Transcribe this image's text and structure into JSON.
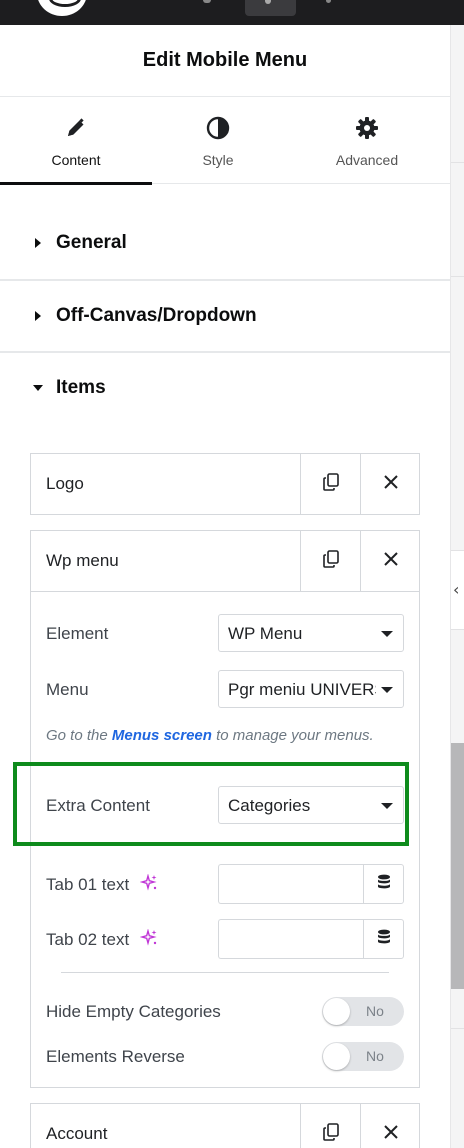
{
  "panel": {
    "title": "Edit Mobile Menu"
  },
  "tabs": [
    {
      "label": "Content",
      "icon": "pencil-icon",
      "active": true
    },
    {
      "label": "Style",
      "icon": "half-circle-icon",
      "active": false
    },
    {
      "label": "Advanced",
      "icon": "gear-icon",
      "active": false
    }
  ],
  "sections": {
    "general": "General",
    "offcanvas": "Off-Canvas/Dropdown",
    "items": "Items"
  },
  "items": {
    "logo": {
      "title": "Logo"
    },
    "wp_menu": {
      "title": "Wp menu",
      "element": {
        "label": "Element",
        "value": "WP Menu"
      },
      "menu": {
        "label": "Menu",
        "value": "Pgr meniu UNIVERSAL"
      },
      "note": {
        "before": "Go to the",
        "link": "Menus screen",
        "after": "to manage your menus."
      },
      "extra_content": {
        "label": "Extra Content",
        "value": "Categories"
      },
      "tab01": {
        "label": "Tab 01 text",
        "value": ""
      },
      "tab02": {
        "label": "Tab 02 text",
        "value": ""
      },
      "hide_empty": {
        "label": "Hide Empty Categories",
        "state": "No"
      },
      "elements_reverse": {
        "label": "Elements Reverse",
        "state": "No"
      }
    },
    "account": {
      "title": "Account"
    }
  },
  "colors": {
    "highlight": "#0e8b1c",
    "link": "#1e66e0",
    "ai_accent": "#c036d6"
  }
}
